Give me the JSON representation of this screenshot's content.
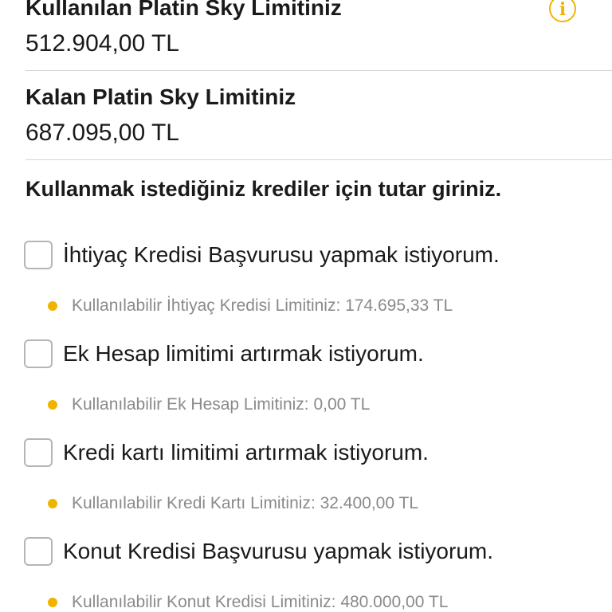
{
  "colors": {
    "accent": "#f0b400",
    "divider": "#d6d6d6",
    "muted_text": "#8a8a8a",
    "checkbox_border": "#b5b5b5"
  },
  "info_icon": {
    "name": "info-icon",
    "glyph": "i"
  },
  "used_limit": {
    "label": "Kullanılan Platin Sky Limitiniz",
    "value": "512.904,00 TL"
  },
  "remaining_limit": {
    "label": "Kalan Platin Sky Limitiniz",
    "value": "687.095,00 TL"
  },
  "instruction": "Kullanmak istediğiniz krediler için tutar giriniz.",
  "options": [
    {
      "label": "İhtiyaç Kredisi Başvurusu yapmak istiyorum.",
      "note": "Kullanılabilir İhtiyaç Kredisi Limitiniz: 174.695,33 TL",
      "checked": false
    },
    {
      "label": "Ek Hesap limitimi artırmak istiyorum.",
      "note": "Kullanılabilir Ek Hesap Limitiniz: 0,00 TL",
      "checked": false
    },
    {
      "label": "Kredi kartı limitimi artırmak istiyorum.",
      "note": "Kullanılabilir Kredi Kartı Limitiniz: 32.400,00 TL",
      "checked": false
    },
    {
      "label": "Konut Kredisi Başvurusu yapmak istiyorum.",
      "note": "Kullanılabilir Konut Kredisi Limitiniz: 480.000,00 TL",
      "checked": false
    }
  ]
}
